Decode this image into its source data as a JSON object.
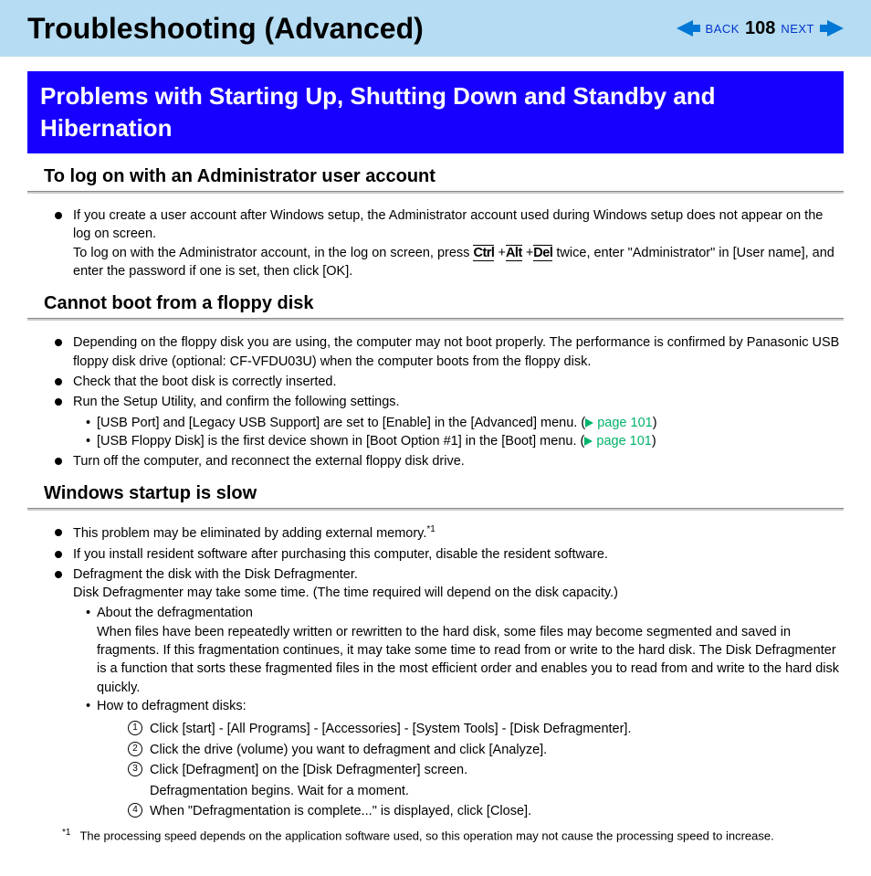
{
  "header": {
    "title": "Troubleshooting (Advanced)",
    "back": "BACK",
    "page": "108",
    "next": "NEXT"
  },
  "banner": "Problems with Starting Up, Shutting Down and Standby and Hibernation",
  "sub1": {
    "heading": "To log on with an Administrator user account",
    "p1a": "If you create a user account after Windows setup, the Administrator account used during Windows setup does not appear on the log on screen.",
    "p1b_pre": "To log on with the Administrator account, in the log on screen, press ",
    "key1": "Ctrl",
    "key2": "Alt",
    "key3": "Del",
    "p1b_post": " twice, enter \"Administrator\" in [User name], and enter the password if one is set, then click [OK]."
  },
  "sub2": {
    "heading": "Cannot boot from a floppy disk",
    "b1": "Depending on the floppy disk you are using, the computer may not boot properly. The performance is confirmed by Panasonic USB floppy disk drive (optional: CF-VFDU03U) when the computer boots from the floppy disk.",
    "b2": "Check that the boot disk is correctly inserted.",
    "b3": "Run the Setup Utility, and confirm the following settings.",
    "b3s1_pre": "[USB Port] and [Legacy USB Support] are set to [Enable] in the [Advanced] menu. (",
    "b3s2_pre": "[USB Floppy Disk] is the first device shown in [Boot Option #1] in the [Boot] menu. (",
    "link": "page 101",
    "b4": "Turn off the computer, and reconnect the external floppy disk drive."
  },
  "sub3": {
    "heading": "Windows startup is slow",
    "b1": "This problem may be eliminated by adding external memory.",
    "b1_sup": "*1",
    "b2": "If you install resident software after purchasing this computer, disable the resident software.",
    "b3a": "Defragment the disk with the Disk Defragmenter.",
    "b3b": "Disk Defragmenter may take some time. (The time required will depend on the disk capacity.)",
    "b3s1_t": "About the defragmentation",
    "b3s1_p": "When files have been repeatedly written or rewritten to the hard disk, some files may become segmented and saved in fragments. If this fragmentation continues, it may take some time to read from or write to the hard disk. The Disk Defragmenter is a function that sorts these fragmented files in the most efficient order and enables you to read from and write to the hard disk quickly.",
    "b3s2_t": "How to defragment disks:",
    "steps": {
      "s1": "Click [start] - [All Programs] - [Accessories] - [System Tools] - [Disk Defragmenter].",
      "s2": "Click the drive (volume) you want to defragment and click [Analyze].",
      "s3a": "Click [Defragment] on the [Disk Defragmenter] screen.",
      "s3b": "Defragmentation begins. Wait for a moment.",
      "s4": "When \"Defragmentation is complete...\" is displayed, click [Close]."
    }
  },
  "footnote": {
    "mark": "*1",
    "text": "The processing speed depends on the application software used, so this operation may not cause the processing speed to increase."
  }
}
